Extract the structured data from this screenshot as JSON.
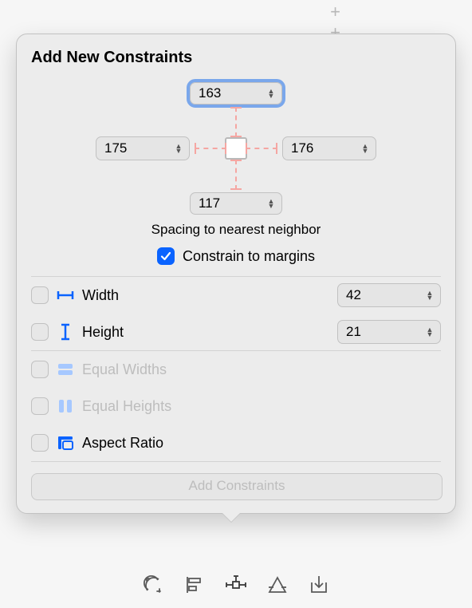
{
  "title": "Add New Constraints",
  "spacing": {
    "top": "163",
    "left": "175",
    "right": "176",
    "bottom": "117",
    "caption": "Spacing to nearest neighbor"
  },
  "constrain_to_margins": {
    "label": "Constrain to margins",
    "checked": true
  },
  "size": {
    "width": {
      "label": "Width",
      "value": "42",
      "checked": false
    },
    "height": {
      "label": "Height",
      "value": "21",
      "checked": false
    }
  },
  "equal": {
    "widths": {
      "label": "Equal Widths",
      "enabled": false
    },
    "heights": {
      "label": "Equal Heights",
      "enabled": false
    }
  },
  "aspect_ratio": {
    "label": "Aspect Ratio",
    "checked": false
  },
  "add_button": "Add Constraints"
}
